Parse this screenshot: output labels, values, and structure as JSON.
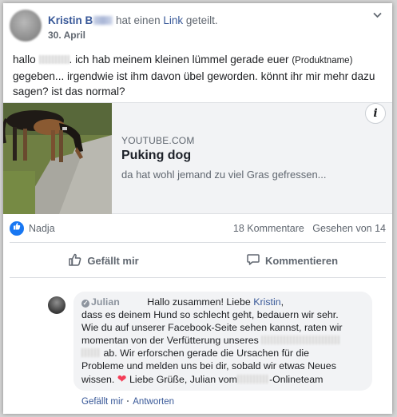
{
  "post": {
    "author_name": "Kristin B",
    "shared_prefix": "hat einen",
    "shared_link": "Link",
    "shared_suffix": "geteilt.",
    "date": "30. April",
    "text_1": "hallo",
    "text_2": ". ich hab meinem kleinen lümmel gerade euer",
    "text_product": "(Produktname)",
    "text_3": "gegeben... irgendwie ist ihm davon übel geworden. könnt ihr mir mehr dazu sagen? ist das normal?"
  },
  "link_card": {
    "source": "YOUTUBE.COM",
    "title": "Puking dog",
    "description": "da hat wohl jemand zu viel Gras gefressen..."
  },
  "reactions": {
    "name": "Nadja",
    "comments": "18 Kommentare",
    "seen": "Gesehen von 14"
  },
  "actions": {
    "like": "Gefällt mir",
    "comment": "Kommentieren"
  },
  "comment": {
    "author": "Julian",
    "greeting": "Hallo zusammen! Liebe",
    "mention": "Kristin",
    "line_1": ",",
    "line_2": "dass es deinem Hund so schlecht geht, bedauern wir sehr.",
    "line_3": "Wie du auf unserer Facebook-Seite sehen kannst, raten wir",
    "line_4": "momentan von der Verfütterung unseres",
    "line_5": "ab. Wir erforschen gerade die Ursachen für die",
    "line_6": "Probleme und melden uns bei dir, sobald wir etwas Neues",
    "line_7a": "wissen.",
    "line_7b": "Liebe Grüße, Julian vom",
    "line_7c": "-Onlineteam",
    "like": "Gefällt mir",
    "reply": "Antworten"
  },
  "colors": {
    "link_blue": "#385898",
    "like_blue": "#1877f2",
    "heart_red": "#f33e58"
  }
}
